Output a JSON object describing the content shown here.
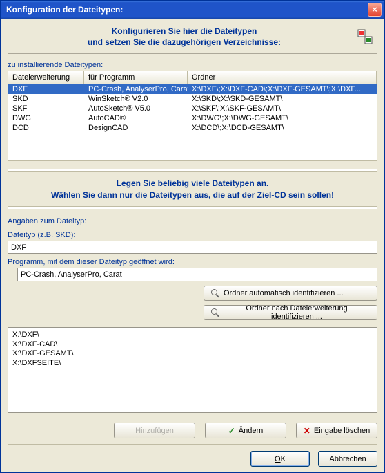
{
  "window": {
    "title": "Konfiguration der Dateitypen:"
  },
  "banner": {
    "line1": "Konfigurieren Sie hier die Dateitypen",
    "line2": "und setzen Sie die dazugehörigen Verzeichnisse:"
  },
  "section_install_label": "zu installierende Dateitypen:",
  "columns": {
    "ext": "Dateierweiterung",
    "prog": "für Programm",
    "folder": "Ordner"
  },
  "rows": [
    {
      "ext": "DXF",
      "prog": "PC-Crash, AnalyserPro, Carat",
      "folder": "X:\\DXF\\;X:\\DXF-CAD\\;X:\\DXF-GESAMT\\;X:\\DXF...",
      "selected": true
    },
    {
      "ext": "SKD",
      "prog": "WinSketch® V2.0",
      "folder": "X:\\SKD\\;X:\\SKD-GESAMT\\",
      "selected": false
    },
    {
      "ext": "SKF",
      "prog": "AutoSketch® V5.0",
      "folder": "X:\\SKF\\;X:\\SKF-GESAMT\\",
      "selected": false
    },
    {
      "ext": "DWG",
      "prog": "AutoCAD®",
      "folder": "X:\\DWG\\;X:\\DWG-GESAMT\\",
      "selected": false
    },
    {
      "ext": "DCD",
      "prog": "DesignCAD",
      "folder": "X:\\DCD\\;X:\\DCD-GESAMT\\",
      "selected": false
    }
  ],
  "info": {
    "line1": "Legen Sie beliebig viele Dateitypen an.",
    "line2": "Wählen Sie dann nur die Dateitypen aus, die auf der Ziel-CD sein sollen!"
  },
  "detail": {
    "section_label": "Angaben zum Dateityp:",
    "filetype_label": "Dateityp (z.B. SKD):",
    "filetype_value": "DXF",
    "program_label": "Programm, mit dem dieser Dateityp geöffnet wird:",
    "program_value": "PC-Crash, AnalyserPro, Carat",
    "btn_auto_folder": "Ordner automatisch identifizieren ...",
    "btn_by_ext": "Ordner nach Dateierweiterung identifizieren ...",
    "folder_list": "X:\\DXF\\\nX:\\DXF-CAD\\\nX:\\DXF-GESAMT\\\nX:\\DXFSEITE\\"
  },
  "actions": {
    "add": "Hinzufügen",
    "modify": "Ändern",
    "delete": "Eingabe löschen"
  },
  "dialog": {
    "ok": "OK",
    "cancel": "Abbrechen"
  }
}
